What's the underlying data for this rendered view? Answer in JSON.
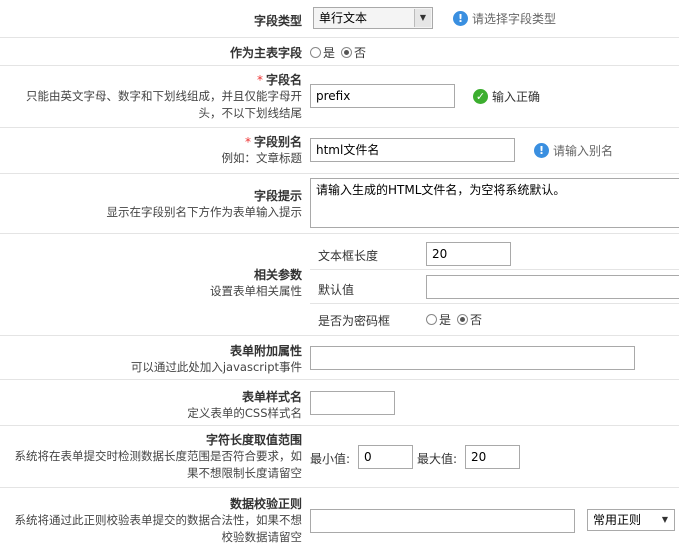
{
  "fields": {
    "type": {
      "label": "字段类型",
      "value": "单行文本",
      "hint": "请选择字段类型"
    },
    "primary": {
      "label": "作为主表字段",
      "opt_yes": "是",
      "opt_no": "否"
    },
    "name": {
      "label": "字段名",
      "desc": "只能由英文字母、数字和下划线组成，并且仅能字母开头，不以下划线结尾",
      "value": "prefix",
      "hint": "输入正确"
    },
    "alias": {
      "label": "字段别名",
      "desc": "例如：文章标题",
      "value": "html文件名",
      "hint": "请输入别名"
    },
    "tip": {
      "label": "字段提示",
      "desc": "显示在字段别名下方作为表单输入提示",
      "value": "请输入生成的HTML文件名，为空将系统默认。"
    },
    "params": {
      "label": "相关参数",
      "desc": "设置表单相关属性",
      "len_label": "文本框长度",
      "len_value": "20",
      "default_label": "默认值",
      "default_value": "",
      "pwd_label": "是否为密码框",
      "opt_yes": "是",
      "opt_no": "否"
    },
    "attr": {
      "label": "表单附加属性",
      "desc": "可以通过此处加入javascript事件",
      "value": ""
    },
    "css": {
      "label": "表单样式名",
      "desc": "定义表单的CSS样式名",
      "value": ""
    },
    "range": {
      "label": "字符长度取值范围",
      "desc": "系统将在表单提交时检测数据长度范围是否符合要求，如果不想限制长度请留空",
      "min_label": "最小值:",
      "min_value": "0",
      "max_label": "最大值:",
      "max_value": "20"
    },
    "regex": {
      "label": "数据校验正则",
      "desc": "系统将通过此正则校验表单提交的数据合法性，如果不想校验数据请留空",
      "value": "",
      "select": "常用正则"
    }
  }
}
